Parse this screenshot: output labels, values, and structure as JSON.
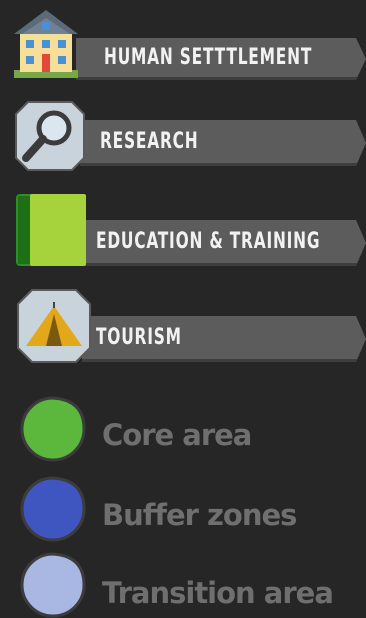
{
  "legend": {
    "activities": [
      {
        "label": "HUMAN SETTTLEMENT",
        "icon": "house-icon"
      },
      {
        "label": "RESEARCH",
        "icon": "magnifier-icon"
      },
      {
        "label": "EDUCATION & TRAINING",
        "icon": "book-icon"
      },
      {
        "label": "TOURISM",
        "icon": "tent-icon"
      }
    ],
    "zones": [
      {
        "label": "Core area",
        "color": "#5bb83c"
      },
      {
        "label": "Buffer zones",
        "color": "#3f55c0"
      },
      {
        "label": "Transition area",
        "color": "#a9b7e3"
      }
    ]
  }
}
